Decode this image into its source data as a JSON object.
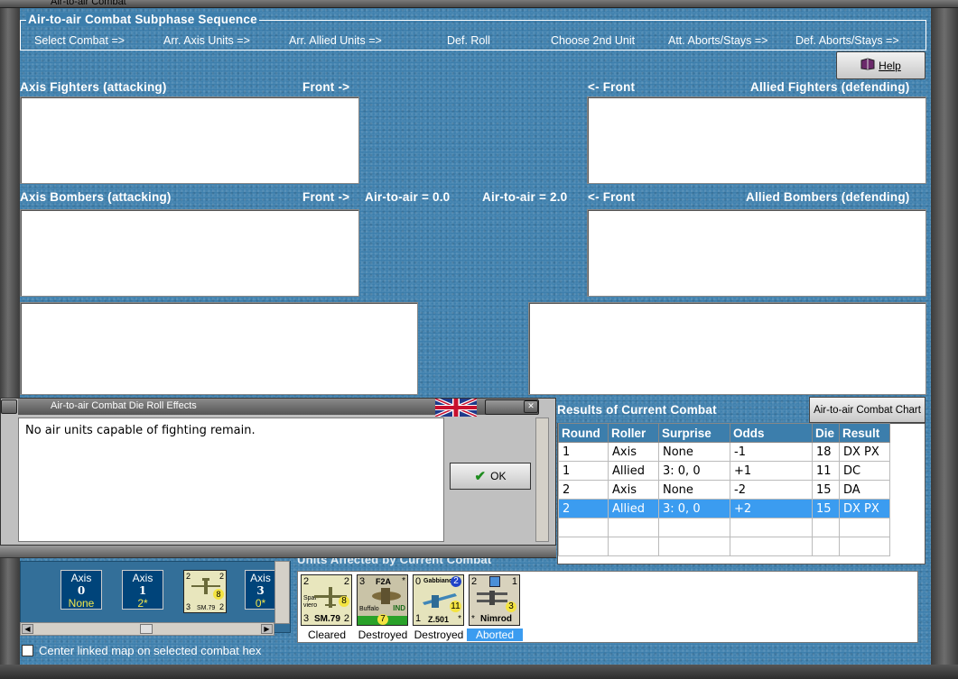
{
  "window": {
    "title": "Air-to-air Combat"
  },
  "sequence": {
    "legend": "Air-to-air Combat Subphase Sequence",
    "steps": [
      "Select Combat =>",
      "Arr. Axis Units =>",
      "Arr. Allied Units =>",
      "Def. Roll",
      "Choose 2nd Unit",
      "Att. Aborts/Stays =>",
      "Def. Aborts/Stays =>"
    ]
  },
  "help": {
    "label": "Help"
  },
  "fighters": {
    "axis_label": "Axis Fighters (attacking)",
    "axis_front": "Front ->",
    "allied_front": "<- Front",
    "allied_label": "Allied Fighters (defending)"
  },
  "bombers": {
    "axis_label": "Axis Bombers (attacking)",
    "axis_front": "Front ->",
    "axis_value": "Air-to-air = 0.0",
    "allied_value": "Air-to-air = 2.0",
    "allied_front": "<- Front",
    "allied_label": "Allied Bombers (defending)"
  },
  "dialog": {
    "title": "Air-to-air Combat Die Roll Effects",
    "message": "No air units capable of fighting remain.",
    "ok_label": "OK",
    "flag_icon": "union-jack-flag-icon"
  },
  "results": {
    "title": "Results of Current Combat",
    "chart_button": "Air-to-air Combat Chart",
    "columns": [
      "Round",
      "Roller",
      "Surprise",
      "Odds",
      "Die",
      "Result"
    ],
    "rows": [
      [
        "1",
        "Axis",
        "None",
        "-1",
        "18",
        "DX PX"
      ],
      [
        "1",
        "Allied",
        "3: 0, 0",
        "+1",
        "11",
        "DC"
      ],
      [
        "2",
        "Axis",
        "None",
        "-2",
        "15",
        "DA"
      ],
      [
        "2",
        "Allied",
        "3: 0, 0",
        "+2",
        "15",
        "DX PX"
      ]
    ],
    "selected_row": 3
  },
  "hex_units": [
    {
      "side": "Axis",
      "num": "0",
      "sub": "None"
    },
    {
      "side": "Axis",
      "num": "1",
      "sub": "2*"
    },
    {
      "side": "Axis",
      "num": "3",
      "sub": "0*"
    }
  ],
  "hex_counter": {
    "tl": "2",
    "tr": "2",
    "mid": "8",
    "bl": "3",
    "br": "2",
    "name": "SM.79"
  },
  "affected": {
    "title": "Units Affected by Current Combat",
    "units": [
      {
        "name": "SM.79",
        "sub": "Spar-viero",
        "tl": "2",
        "tr": "2",
        "bl": "3",
        "br": "2",
        "val": "8",
        "status": "Cleared",
        "bg": "#e8e6bd"
      },
      {
        "name": "F2A",
        "sub": "Buffalo",
        "tag": "IND",
        "tl": "3",
        "tr": "*",
        "bl": "",
        "br": "",
        "val": "7",
        "status": "Destroyed",
        "bg": "#c9c3a7"
      },
      {
        "name": "Z.501",
        "sub": "Gabbiano",
        "tl": "0",
        "tr": "2",
        "bl": "1",
        "br": "*",
        "val": "11",
        "status": "Destroyed",
        "bg": "#e5e3bc"
      },
      {
        "name": "Nimrod",
        "sub": "",
        "tl": "2",
        "tr": "1",
        "bl": "*",
        "br": "",
        "val": "3",
        "status": "Aborted",
        "bg": "#d8d2bd"
      }
    ]
  },
  "footer": {
    "center_map_label": "Center linked map on selected combat hex"
  },
  "colors": {
    "background": "#3c7eac",
    "selected_row": "#3b9cf0",
    "hex_unit_bg": "#00447a",
    "hex_unit_sub": "#f1e64c"
  }
}
